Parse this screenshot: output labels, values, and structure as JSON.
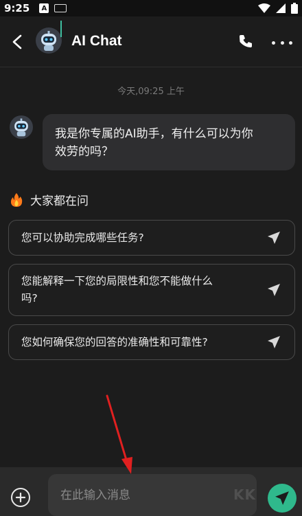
{
  "status_bar": {
    "time": "9:25",
    "a_badge": "A"
  },
  "header": {
    "title": "AI Chat"
  },
  "chat": {
    "timestamp": "今天,09:25 上午",
    "bot_message_line1": "我是你专属的AI助手，有什么可以为你",
    "bot_message_line2": "效劳的吗？"
  },
  "popular": {
    "label": "大家都在问",
    "questions": [
      {
        "line1": "您可以协助完成哪些任务?",
        "line2": ""
      },
      {
        "line1": "您能解释一下您的局限性和您不能做什么",
        "line2": "吗?"
      },
      {
        "line1": "您如何确保您的回答的准确性和可靠性?",
        "line2": ""
      }
    ]
  },
  "input": {
    "placeholder": "在此输入消息"
  },
  "watermark": "KK",
  "colors": {
    "background": "#1c1c1c",
    "bubble": "#2e2e30",
    "accent": "#2fb98c",
    "arrow": "#e02020"
  }
}
